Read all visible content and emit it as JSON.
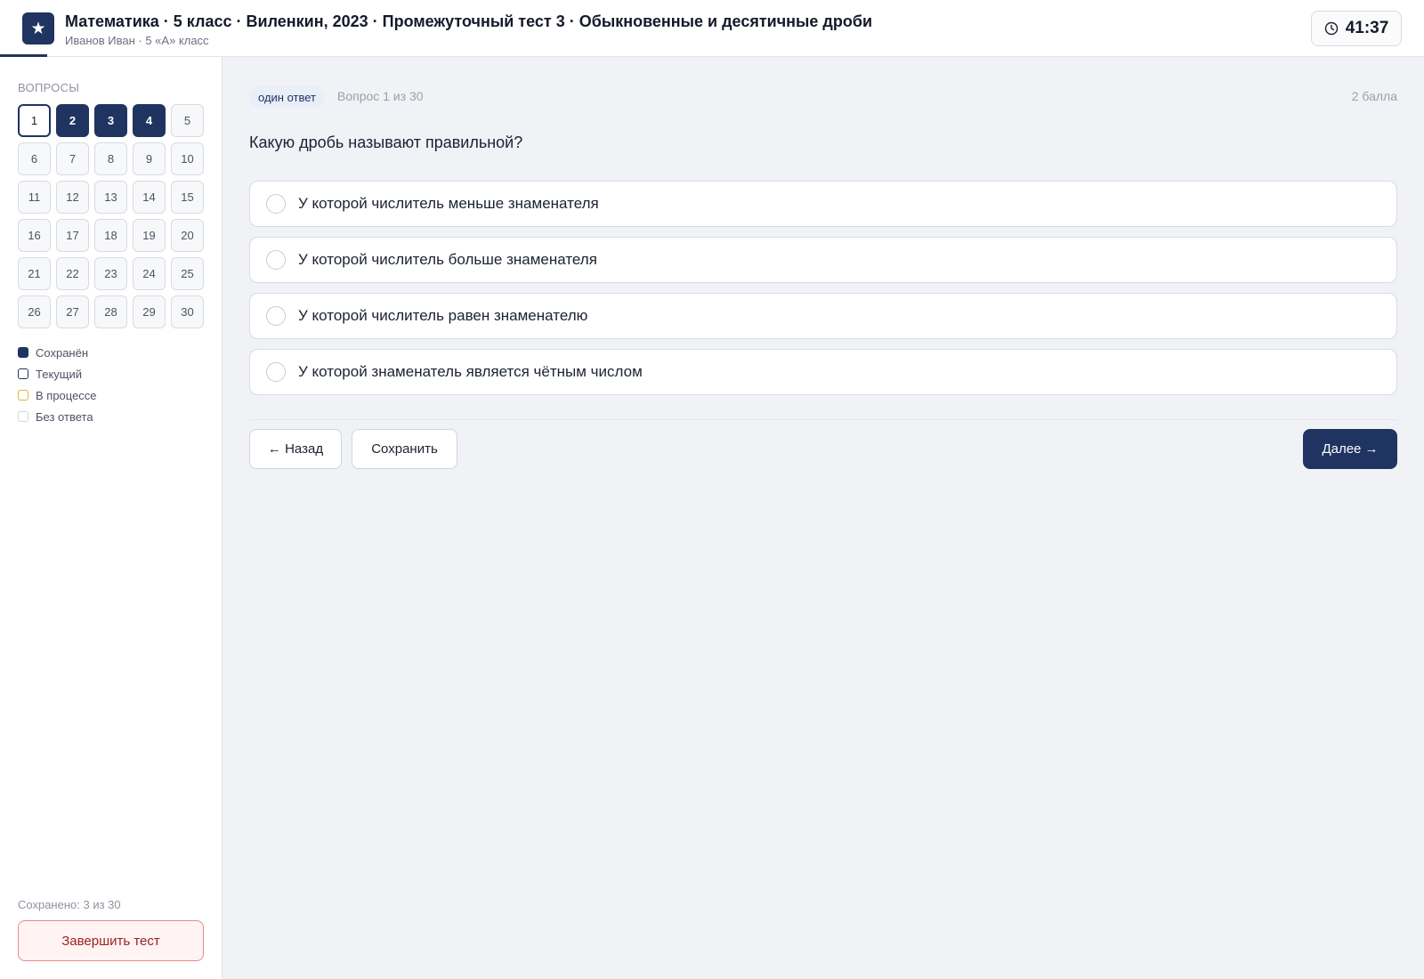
{
  "header": {
    "logo_glyph": "★",
    "title": "Математика · 5 класс · Виленкин, 2023 · Промежуточный тест 3 · Обыкновенные и десятичные дроби",
    "subtitle": "Иванов Иван · 5 «А» класс",
    "timer": "41:37",
    "timer_icon": "clock-icon",
    "progress_fraction": 0.033
  },
  "sidebar": {
    "label": "Вопросы",
    "questions": [
      {
        "n": "1",
        "state": "current"
      },
      {
        "n": "2",
        "state": "saved"
      },
      {
        "n": "3",
        "state": "saved"
      },
      {
        "n": "4",
        "state": "saved"
      },
      {
        "n": "5",
        "state": "none"
      },
      {
        "n": "6",
        "state": "none"
      },
      {
        "n": "7",
        "state": "none"
      },
      {
        "n": "8",
        "state": "none"
      },
      {
        "n": "9",
        "state": "none"
      },
      {
        "n": "10",
        "state": "none"
      },
      {
        "n": "11",
        "state": "none"
      },
      {
        "n": "12",
        "state": "none"
      },
      {
        "n": "13",
        "state": "none"
      },
      {
        "n": "14",
        "state": "none"
      },
      {
        "n": "15",
        "state": "none"
      },
      {
        "n": "16",
        "state": "none"
      },
      {
        "n": "17",
        "state": "none"
      },
      {
        "n": "18",
        "state": "none"
      },
      {
        "n": "19",
        "state": "none"
      },
      {
        "n": "20",
        "state": "none"
      },
      {
        "n": "21",
        "state": "none"
      },
      {
        "n": "22",
        "state": "none"
      },
      {
        "n": "23",
        "state": "none"
      },
      {
        "n": "24",
        "state": "none"
      },
      {
        "n": "25",
        "state": "none"
      },
      {
        "n": "26",
        "state": "none"
      },
      {
        "n": "27",
        "state": "none"
      },
      {
        "n": "28",
        "state": "none"
      },
      {
        "n": "29",
        "state": "none"
      },
      {
        "n": "30",
        "state": "none"
      }
    ],
    "legend": [
      {
        "key": "saved",
        "label": "Сохранён"
      },
      {
        "key": "current",
        "label": "Текущий"
      },
      {
        "key": "progress",
        "label": "В процессе"
      },
      {
        "key": "none",
        "label": "Без ответа"
      }
    ],
    "saved_count": "Сохранено: 3 из 30",
    "finish_label": "Завершить тест"
  },
  "main": {
    "question_type": "один ответ",
    "question_number": "Вопрос 1 из 30",
    "points": "2 балла",
    "question_text": "Какую дробь называют правильной?",
    "options": [
      "У которой числитель меньше знаменателя",
      "У которой числитель больше знаменателя",
      "У которой числитель равен знаменателю",
      "У которой знаменатель является чётным числом"
    ],
    "back_label": "← Назад",
    "save_label": "Сохранить",
    "next_label": "Далее →"
  },
  "colors": {
    "accent": "#1f3461",
    "finish_border": "#e58a8a",
    "in_progress": "#e5b23a"
  }
}
